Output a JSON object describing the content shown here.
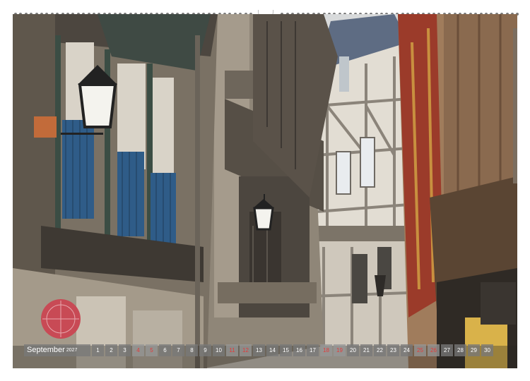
{
  "calendar": {
    "month": "September",
    "year": "2027",
    "days": [
      "1",
      "2",
      "3",
      "4",
      "5",
      "6",
      "7",
      "8",
      "9",
      "10",
      "11",
      "12",
      "13",
      "14",
      "15",
      "16",
      "17",
      "18",
      "19",
      "20",
      "21",
      "22",
      "23",
      "24",
      "25",
      "26",
      "27",
      "28",
      "29",
      "30"
    ],
    "sundays": [
      "4",
      "5",
      "11",
      "12",
      "18",
      "19",
      "25",
      "26"
    ]
  },
  "photo": {
    "subject": "old-town-half-timbered-street",
    "colors": {
      "sky": "#cfd4d8",
      "stone": "#8f8678",
      "dark": "#3f3a35",
      "blue_railing": "#2f5c88",
      "red_beam": "#9b3b2a",
      "plaster": "#e2ddd3"
    }
  }
}
